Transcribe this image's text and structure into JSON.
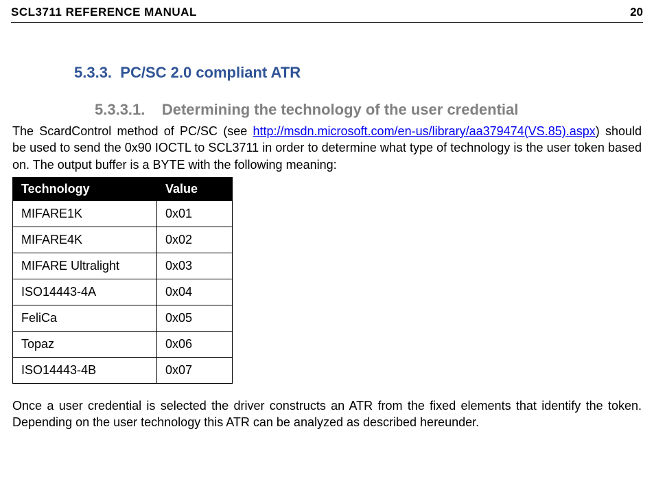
{
  "header": {
    "title_left": "SCL3711 REFERENCE MANUAL",
    "page_number": "20"
  },
  "h3": {
    "num": "5.3.3.",
    "title": "PC/SC 2.0 compliant ATR"
  },
  "h4": {
    "num": "5.3.3.1.",
    "title": "Determining the technology of the user credential"
  },
  "p1a": "The ScardControl method of PC/SC (see ",
  "link": "http://msdn.microsoft.com/en-us/library/aa379474(VS.85).aspx",
  "p1b": ")  should be used to send the 0x90 IOCTL to SCL3711 in order to determine what type of technology is the user token based on. The output buffer is a BYTE with the following meaning:",
  "table": {
    "head": {
      "c1": "Technology",
      "c2": "Value"
    },
    "rows": [
      {
        "c1": "MIFARE1K",
        "c2": "0x01"
      },
      {
        "c1": "MIFARE4K",
        "c2": "0x02"
      },
      {
        "c1": "MIFARE Ultralight",
        "c2": "0x03"
      },
      {
        "c1": "ISO14443-4A",
        "c2": "0x04"
      },
      {
        "c1": "FeliCa",
        "c2": "0x05"
      },
      {
        "c1": "Topaz",
        "c2": "0x06"
      },
      {
        "c1": "ISO14443-4B",
        "c2": "0x07"
      }
    ]
  },
  "p2": "Once a user credential is selected the driver constructs an ATR from the fixed elements that identify the token. Depending on the user technology this ATR can be analyzed as described hereunder."
}
